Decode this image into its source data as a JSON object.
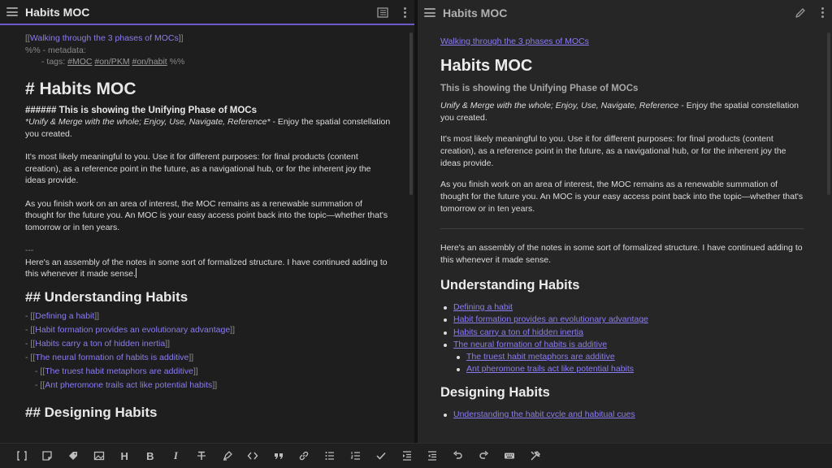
{
  "left": {
    "title": "Habits MOC",
    "breadcrumb_link": "Walking through the 3 phases of MOCs",
    "meta_line1": "%% - metadata:",
    "meta_tags_prefix": "- tags: ",
    "tags": [
      "#MOC",
      "#on/PKM",
      "#on/habit"
    ],
    "meta_suffix": "%%",
    "h1": "# Habits MOC",
    "h6": "###### This is showing the Unifying Phase of MOCs",
    "italic_line": "*Unify & Merge with the whole; Enjoy, Use, Navigate, Reference*",
    "italic_rest": " - Enjoy the spatial constellation you created.",
    "para1": "It's most likely meaningful to you. Use it for different purposes: for final products (content creation), as a reference point in the future, as a navigational hub, or for the inherent joy the ideas provide.",
    "para2": "As you finish work on an area of interest, the MOC remains as a renewable summation of thought for the future you. An MOC is your easy access point back into the topic—whether that's tomorrow or in ten years.",
    "hr": "---",
    "para3": "Here's an assembly of the notes in some sort of formalized structure. I have continued adding to this whenever it made sense.",
    "h2_understanding": "## Understanding Habits",
    "list": [
      "Defining a habit",
      "Habit formation provides an evolutionary advantage",
      "Habits carry a ton of hidden inertia",
      "The neural formation of habits is additive"
    ],
    "sublist": [
      "The truest habit metaphors are additive",
      "Ant pheromone trails act like potential habits"
    ],
    "h2_designing": "## Designing Habits"
  },
  "right": {
    "title": "Habits MOC",
    "breadcrumb_link": "Walking through the 3 phases of MOCs",
    "h1": "Habits MOC",
    "h6": "This is showing the Unifying Phase of MOCs",
    "italic_line": "Unify & Merge with the whole; Enjoy, Use, Navigate, Reference",
    "italic_rest": " - Enjoy the spatial constellation you created.",
    "para1": "It's most likely meaningful to you. Use it for different purposes: for final products (content creation), as a reference point in the future, as a navigational hub, or for the inherent joy the ideas provide.",
    "para2": "As you finish work on an area of interest, the MOC remains as a renewable summation of thought for the future you. An MOC is your easy access point back into the topic—whether that's tomorrow or in ten years.",
    "para3": "Here's an assembly of the notes in some sort of formalized structure. I have continued adding to this whenever it made sense.",
    "h2_understanding": "Understanding Habits",
    "list": [
      "Defining a habit",
      "Habit formation provides an evolutionary advantage",
      "Habits carry a ton of hidden inertia",
      "The neural formation of habits is additive"
    ],
    "sublist": [
      "The truest habit metaphors are additive",
      "Ant pheromone trails act like potential habits"
    ],
    "h2_designing": "Designing Habits",
    "designing_list": [
      "Understanding the habit cycle and habitual cues"
    ]
  },
  "toolbar": {
    "items": [
      "wikilink-icon",
      "embed-icon",
      "tag-icon",
      "image-icon",
      "heading-icon",
      "bold-icon",
      "italic-icon",
      "strikethrough-icon",
      "highlight-icon",
      "code-icon",
      "quote-icon",
      "link-icon",
      "bullet-list-icon",
      "numbered-list-icon",
      "checklist-icon",
      "indent-icon",
      "outdent-icon",
      "undo-icon",
      "redo-icon",
      "keyboard-icon",
      "settings-tools-icon"
    ],
    "glyph_heading": "H",
    "glyph_bold": "B",
    "glyph_italic": "I"
  },
  "colors": {
    "accent": "#8a7df0",
    "active_border": "#6a5acd",
    "bg_left": "#1e1e1e",
    "bg_right": "#262626"
  }
}
